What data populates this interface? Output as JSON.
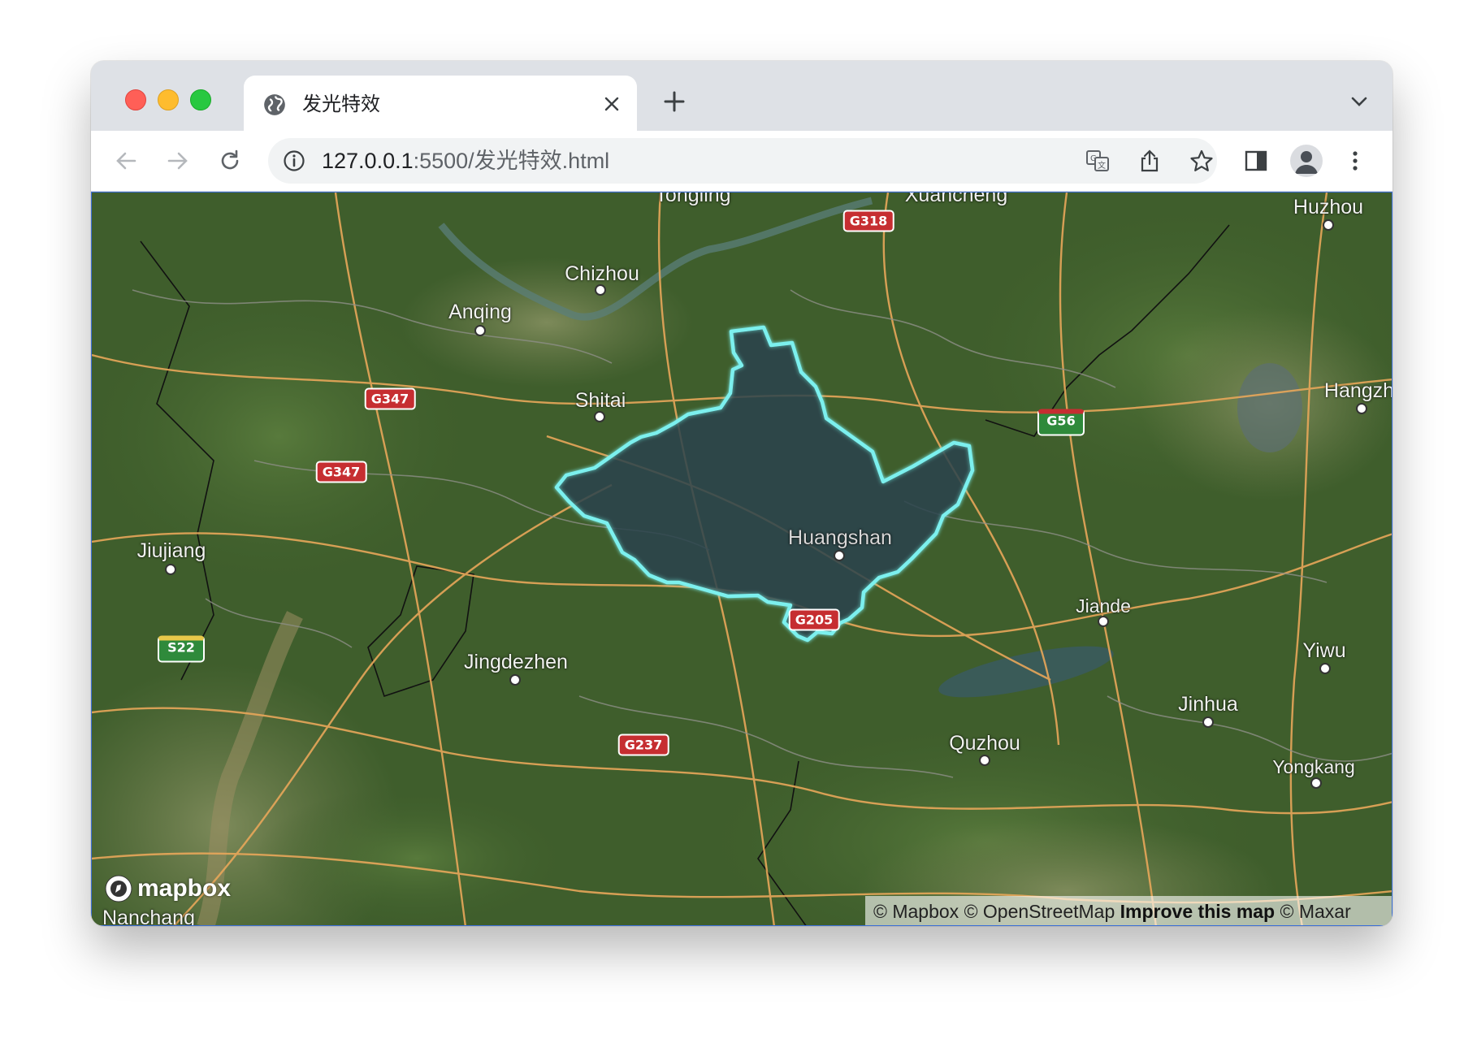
{
  "window": {
    "tab": {
      "title": "发光特效",
      "icon": "globe-icon"
    },
    "new_tab_icon": "plus-icon",
    "tab_search_icon": "chevron-down-icon"
  },
  "toolbar": {
    "url_host": "127.0.0.1",
    "url_rest": ":5500/发光特效.html",
    "icons": [
      "back-arrow-icon",
      "forward-arrow-icon",
      "reload-icon",
      "info-icon",
      "translate-icon",
      "share-icon",
      "star-icon",
      "side-panel-icon",
      "profile-icon",
      "more-vert-icon"
    ]
  },
  "map": {
    "highlight_color": "#7cf0ee",
    "highlight_region": "Huangshan",
    "cities": {
      "tongling": "Tongling",
      "xuancheng": "Xuancheng",
      "huzhou": "Huzhou",
      "chizhou": "Chizhou",
      "anqing": "Anqing",
      "hangzhou": "Hangzh",
      "shitai": "Shitai",
      "jiujiang": "Jiujiang",
      "huangshan": "Huangshan",
      "jiande": "Jiande",
      "yiwu": "Yiwu",
      "jingdezhen": "Jingdezhen",
      "jinhua": "Jinhua",
      "quzhou": "Quzhou",
      "yongkang": "Yongkang",
      "nanchang": "Nanchang"
    },
    "shields": {
      "g318": "G318",
      "g347a": "G347",
      "g347b": "G347",
      "g56": "G56",
      "g205": "G205",
      "s22": "S22",
      "g237": "G237"
    },
    "logo_text": "mapbox",
    "attribution": {
      "mapbox": "© Mapbox",
      "osm": "© OpenStreetMap",
      "improve": "Improve this map",
      "maxar": "© Maxar"
    }
  }
}
